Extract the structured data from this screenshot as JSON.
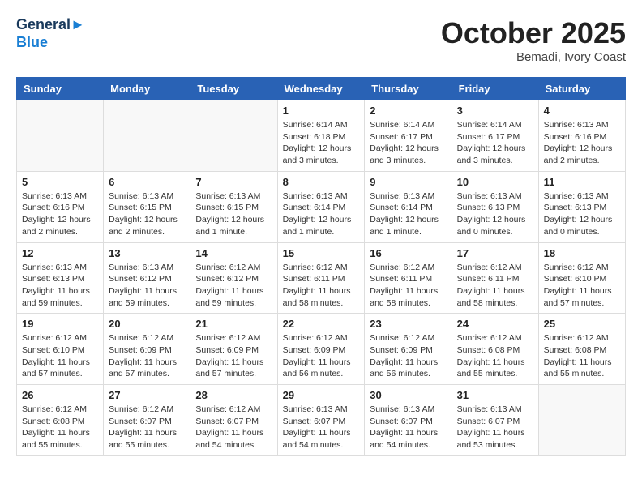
{
  "header": {
    "logo_line1": "General",
    "logo_line2": "Blue",
    "month": "October 2025",
    "location": "Bemadi, Ivory Coast"
  },
  "days_of_week": [
    "Sunday",
    "Monday",
    "Tuesday",
    "Wednesday",
    "Thursday",
    "Friday",
    "Saturday"
  ],
  "weeks": [
    [
      {
        "day": "",
        "text": ""
      },
      {
        "day": "",
        "text": ""
      },
      {
        "day": "",
        "text": ""
      },
      {
        "day": "1",
        "text": "Sunrise: 6:14 AM\nSunset: 6:18 PM\nDaylight: 12 hours\nand 3 minutes."
      },
      {
        "day": "2",
        "text": "Sunrise: 6:14 AM\nSunset: 6:17 PM\nDaylight: 12 hours\nand 3 minutes."
      },
      {
        "day": "3",
        "text": "Sunrise: 6:14 AM\nSunset: 6:17 PM\nDaylight: 12 hours\nand 3 minutes."
      },
      {
        "day": "4",
        "text": "Sunrise: 6:13 AM\nSunset: 6:16 PM\nDaylight: 12 hours\nand 2 minutes."
      }
    ],
    [
      {
        "day": "5",
        "text": "Sunrise: 6:13 AM\nSunset: 6:16 PM\nDaylight: 12 hours\nand 2 minutes."
      },
      {
        "day": "6",
        "text": "Sunrise: 6:13 AM\nSunset: 6:15 PM\nDaylight: 12 hours\nand 2 minutes."
      },
      {
        "day": "7",
        "text": "Sunrise: 6:13 AM\nSunset: 6:15 PM\nDaylight: 12 hours\nand 1 minute."
      },
      {
        "day": "8",
        "text": "Sunrise: 6:13 AM\nSunset: 6:14 PM\nDaylight: 12 hours\nand 1 minute."
      },
      {
        "day": "9",
        "text": "Sunrise: 6:13 AM\nSunset: 6:14 PM\nDaylight: 12 hours\nand 1 minute."
      },
      {
        "day": "10",
        "text": "Sunrise: 6:13 AM\nSunset: 6:13 PM\nDaylight: 12 hours\nand 0 minutes."
      },
      {
        "day": "11",
        "text": "Sunrise: 6:13 AM\nSunset: 6:13 PM\nDaylight: 12 hours\nand 0 minutes."
      }
    ],
    [
      {
        "day": "12",
        "text": "Sunrise: 6:13 AM\nSunset: 6:13 PM\nDaylight: 11 hours\nand 59 minutes."
      },
      {
        "day": "13",
        "text": "Sunrise: 6:13 AM\nSunset: 6:12 PM\nDaylight: 11 hours\nand 59 minutes."
      },
      {
        "day": "14",
        "text": "Sunrise: 6:12 AM\nSunset: 6:12 PM\nDaylight: 11 hours\nand 59 minutes."
      },
      {
        "day": "15",
        "text": "Sunrise: 6:12 AM\nSunset: 6:11 PM\nDaylight: 11 hours\nand 58 minutes."
      },
      {
        "day": "16",
        "text": "Sunrise: 6:12 AM\nSunset: 6:11 PM\nDaylight: 11 hours\nand 58 minutes."
      },
      {
        "day": "17",
        "text": "Sunrise: 6:12 AM\nSunset: 6:11 PM\nDaylight: 11 hours\nand 58 minutes."
      },
      {
        "day": "18",
        "text": "Sunrise: 6:12 AM\nSunset: 6:10 PM\nDaylight: 11 hours\nand 57 minutes."
      }
    ],
    [
      {
        "day": "19",
        "text": "Sunrise: 6:12 AM\nSunset: 6:10 PM\nDaylight: 11 hours\nand 57 minutes."
      },
      {
        "day": "20",
        "text": "Sunrise: 6:12 AM\nSunset: 6:09 PM\nDaylight: 11 hours\nand 57 minutes."
      },
      {
        "day": "21",
        "text": "Sunrise: 6:12 AM\nSunset: 6:09 PM\nDaylight: 11 hours\nand 57 minutes."
      },
      {
        "day": "22",
        "text": "Sunrise: 6:12 AM\nSunset: 6:09 PM\nDaylight: 11 hours\nand 56 minutes."
      },
      {
        "day": "23",
        "text": "Sunrise: 6:12 AM\nSunset: 6:09 PM\nDaylight: 11 hours\nand 56 minutes."
      },
      {
        "day": "24",
        "text": "Sunrise: 6:12 AM\nSunset: 6:08 PM\nDaylight: 11 hours\nand 55 minutes."
      },
      {
        "day": "25",
        "text": "Sunrise: 6:12 AM\nSunset: 6:08 PM\nDaylight: 11 hours\nand 55 minutes."
      }
    ],
    [
      {
        "day": "26",
        "text": "Sunrise: 6:12 AM\nSunset: 6:08 PM\nDaylight: 11 hours\nand 55 minutes."
      },
      {
        "day": "27",
        "text": "Sunrise: 6:12 AM\nSunset: 6:07 PM\nDaylight: 11 hours\nand 55 minutes."
      },
      {
        "day": "28",
        "text": "Sunrise: 6:12 AM\nSunset: 6:07 PM\nDaylight: 11 hours\nand 54 minutes."
      },
      {
        "day": "29",
        "text": "Sunrise: 6:13 AM\nSunset: 6:07 PM\nDaylight: 11 hours\nand 54 minutes."
      },
      {
        "day": "30",
        "text": "Sunrise: 6:13 AM\nSunset: 6:07 PM\nDaylight: 11 hours\nand 54 minutes."
      },
      {
        "day": "31",
        "text": "Sunrise: 6:13 AM\nSunset: 6:07 PM\nDaylight: 11 hours\nand 53 minutes."
      },
      {
        "day": "",
        "text": ""
      }
    ]
  ]
}
